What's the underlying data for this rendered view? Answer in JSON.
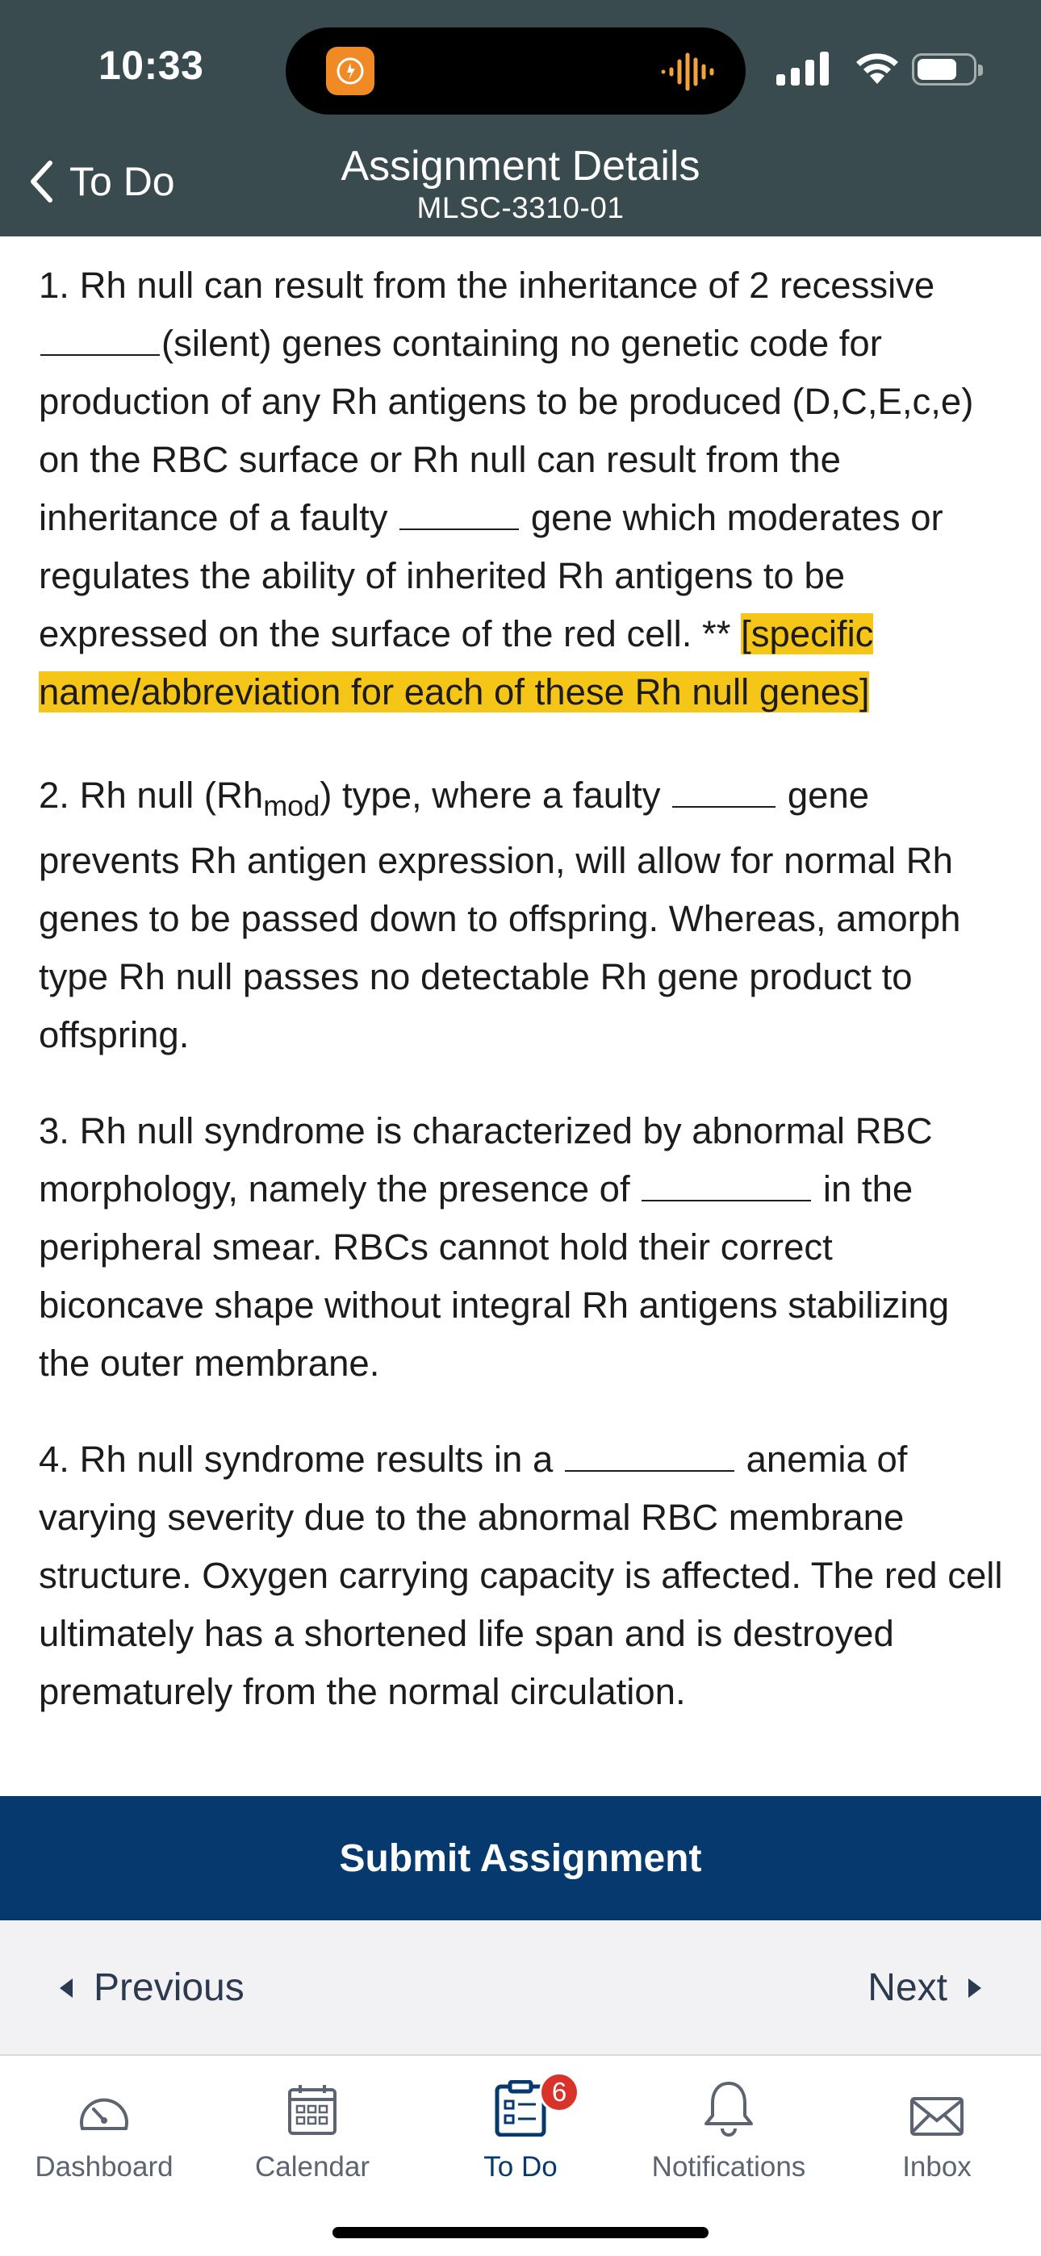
{
  "status_bar": {
    "time": "10:33",
    "icons": [
      "app-activity-icon",
      "audio-waveform-icon",
      "signal-icon",
      "wifi-icon",
      "battery-icon"
    ]
  },
  "nav": {
    "back_label": "To Do",
    "title": "Assignment Details",
    "subtitle": "MLSC-3310-01"
  },
  "questions": {
    "q1": {
      "a": "1.  Rh null can result from the inheritance of 2 recessive ",
      "b": "(silent) genes containing no genetic code for production of any Rh antigens to be produced (D,C,E,c,e) on the RBC surface or Rh null can result from the inheritance of a faulty ",
      "c": " gene which moderates or regulates  the ability of inherited Rh antigens to be expressed on the surface of the red cell.  ** ",
      "highlight": "[specific name/abbreviation for each of these Rh null genes]"
    },
    "q2": {
      "a": "2. Rh null (Rh",
      "sub": "mod",
      "b": ") type, where a faulty ",
      "c": " gene",
      "d": "prevents Rh antigen expression, will allow for normal Rh genes to be passed down to offspring. Whereas, amorph type Rh null passes no detectable Rh gene product to offspring."
    },
    "q3": {
      "a": "3. Rh null syndrome is characterized by abnormal RBC morphology, namely the presence of ",
      "b": " in the peripheral smear. RBCs cannot hold their correct biconcave shape without integral Rh antigens stabilizing the outer membrane."
    },
    "q4": {
      "a": "4. Rh null syndrome results in a ",
      "b": " anemia of varying severity due to the abnormal RBC membrane structure. Oxygen carrying capacity is affected. The red cell ultimately has a shortened life span and is destroyed prematurely from the normal circulation."
    }
  },
  "actions": {
    "submit_label": "Submit Assignment",
    "previous_label": "Previous",
    "next_label": "Next"
  },
  "tabs": [
    {
      "label": "Dashboard",
      "icon": "dashboard-icon"
    },
    {
      "label": "Calendar",
      "icon": "calendar-icon"
    },
    {
      "label": "To Do",
      "icon": "todo-icon",
      "badge": "6",
      "active": true
    },
    {
      "label": "Notifications",
      "icon": "bell-icon"
    },
    {
      "label": "Inbox",
      "icon": "envelope-icon"
    }
  ],
  "colors": {
    "header": "#394b4f",
    "submit": "#063a6e",
    "highlight": "#f5c518",
    "badge": "#d9322b"
  }
}
